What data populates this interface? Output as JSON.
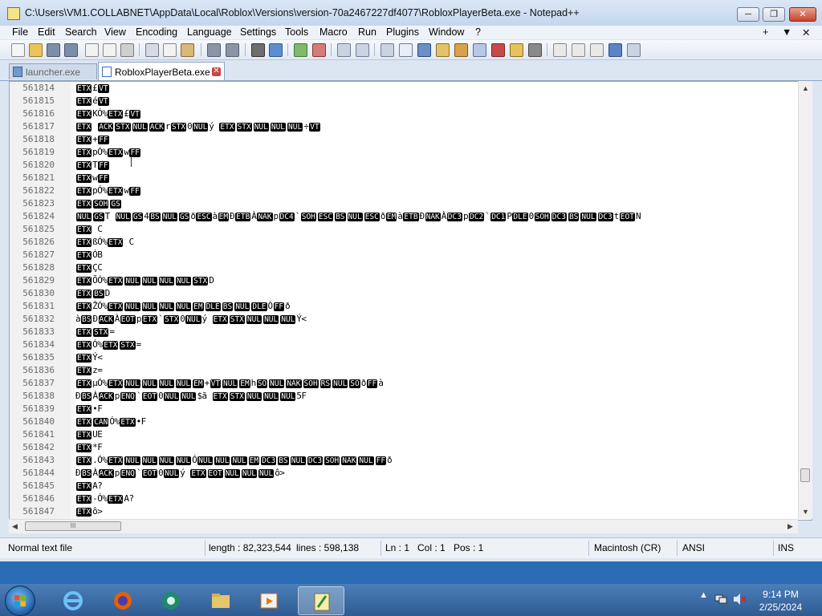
{
  "window": {
    "title": "C:\\Users\\VM1.COLLABNET\\AppData\\Local\\Roblox\\Versions\\version-70a2467227df4077\\RobloxPlayerBeta.exe - Notepad++",
    "minimize": "─",
    "maximize": "❐",
    "close": "✕"
  },
  "menu": {
    "items": [
      "File",
      "Edit",
      "Search",
      "View",
      "Encoding",
      "Language",
      "Settings",
      "Tools",
      "Macro",
      "Run",
      "Plugins",
      "Window",
      "?"
    ],
    "right": [
      "+",
      "▼",
      "✕"
    ]
  },
  "tabs": [
    {
      "label": "launcher.exe",
      "active": false
    },
    {
      "label": "RobloxPlayerBeta.exe",
      "active": true
    }
  ],
  "tab_close": "✕",
  "editor": {
    "lines": [
      {
        "n": "561814",
        "t": "[ETX]£[VT]"
      },
      {
        "n": "561815",
        "t": "[ETX]é[VT]"
      },
      {
        "n": "561816",
        "t": "[ETX]KÓ%[ETX]£[VT]"
      },
      {
        "n": "561817",
        "t": "[ETX] [ACK][STX][NUL][ACK]r[STX]0[NUL]ý [ETX][STX][NUL][NUL][NUL]÷[VT]"
      },
      {
        "n": "561818",
        "t": "[ETX]+[FF]"
      },
      {
        "n": "561819",
        "t": "[ETX]pÓ%[ETX]w[FF]"
      },
      {
        "n": "561820",
        "t": "[ETX]T[FF]"
      },
      {
        "n": "561821",
        "t": "[ETX]w[FF]"
      },
      {
        "n": "561822",
        "t": "[ETX]pÓ%[ETX]w[FF]"
      },
      {
        "n": "561823",
        "t": "[ETX][SOH][GS]"
      },
      {
        "n": "561824",
        "t": "[NUL][GS]T [NUL][GS]4[BS][NUL][GS]ð[ESC]à[EM]Ð[ETB]À[NAK]p[DC4]`[SOH][ESC][BS][NUL][ESC]ð[EM]à[ETB]Ð[NAK]À[DC3]p[DC2]`[DC1]P[DLE]0[SOH][DC3][BS][NUL][DC3]t[EOT]N"
      },
      {
        "n": "561825",
        "t": "[ETX] C"
      },
      {
        "n": "561826",
        "t": "[ETX]ßÓ%[ETX] C"
      },
      {
        "n": "561827",
        "t": "[ETX]ÓB"
      },
      {
        "n": "561828",
        "t": "[ETX]ÇC"
      },
      {
        "n": "561829",
        "t": "[ETX]ÕÓ%[ETX][NUL][NUL][NUL][NUL][STX]D"
      },
      {
        "n": "561830",
        "t": "[ETX][BS]D"
      },
      {
        "n": "561831",
        "t": "[ETX]ŽÓ%[ETX][NUL][NUL][NUL][NUL][EM][DLE][BS][NUL][DLE]Ò[FF]ð"
      },
      {
        "n": "561832",
        "t": "à[BS]Ð[ACK]À[EOT]p[ETX]`[STX]0[NUL]ý  [ETX][STX][NUL][NUL][NUL]Ý<"
      },
      {
        "n": "561833",
        "t": "[ETX][STX]="
      },
      {
        "n": "561834",
        "t": "[ETX]Ó%[ETX][STX]="
      },
      {
        "n": "561835",
        "t": "[ETX]Ý<"
      },
      {
        "n": "561836",
        "t": "[ETX]z="
      },
      {
        "n": "561837",
        "t": "[ETX]µÓ%[ETX][NUL][NUL][NUL][NUL][EM]+[VT][NUL][EM]h[SO][NUL][NAK][SOH][RS][NUL][SO]ð[FF]à"
      },
      {
        "n": "561838",
        "t": "Ð[BS]À[ACK]p[ENQ]`[EOT]0[NUL][NUL]$ã  [ETX][STX][NUL][NUL][NUL]5F"
      },
      {
        "n": "561839",
        "t": "[ETX]•F"
      },
      {
        "n": "561840",
        "t": "[ETX][CAN]Ó%[ETX]•F"
      },
      {
        "n": "561841",
        "t": "[ETX]UE"
      },
      {
        "n": "561842",
        "t": "[ETX]*F"
      },
      {
        "n": "561843",
        "t": "[ETX].Ó%[ETX][NUL][NUL][NUL][NUL]Ó[NUL][NUL][NUL][EM][DC3][BS][NUL][DC3][SOH][NAK][NUL][FF]ð"
      },
      {
        "n": "561844",
        "t": "Ð[BS]À[ACK]p[ENQ]`[EOT]0[NUL]ý  [ETX][EOT][NUL][NUL][NUL]ô>"
      },
      {
        "n": "561845",
        "t": "[ETX]A?"
      },
      {
        "n": "561846",
        "t": "[ETX]-Ó%[ETX]A?"
      },
      {
        "n": "561847",
        "t": "[ETX]ô>"
      }
    ]
  },
  "scroll": {
    "h_thumb_glyph": "III",
    "up": "▲",
    "down": "▼",
    "left": "◀",
    "right": "▶"
  },
  "status": {
    "type": "Normal text file",
    "length": "length : 82,323,544",
    "lines": "lines : 598,138",
    "ln": "Ln : 1",
    "col": "Col : 1",
    "pos": "Pos : 1",
    "eol": "Macintosh (CR)",
    "encoding": "ANSI",
    "mode": "INS"
  },
  "taskbar": {
    "apps": [
      "internet-explorer",
      "firefox",
      "media-app",
      "file-explorer",
      "media-player",
      "notepad-plus-plus"
    ],
    "time": "9:14 PM",
    "date": "2/25/2024"
  },
  "colors": {
    "accent": "#2a6cb3",
    "ctrl_bg": "#000000",
    "ctrl_fg": "#ffffff"
  }
}
